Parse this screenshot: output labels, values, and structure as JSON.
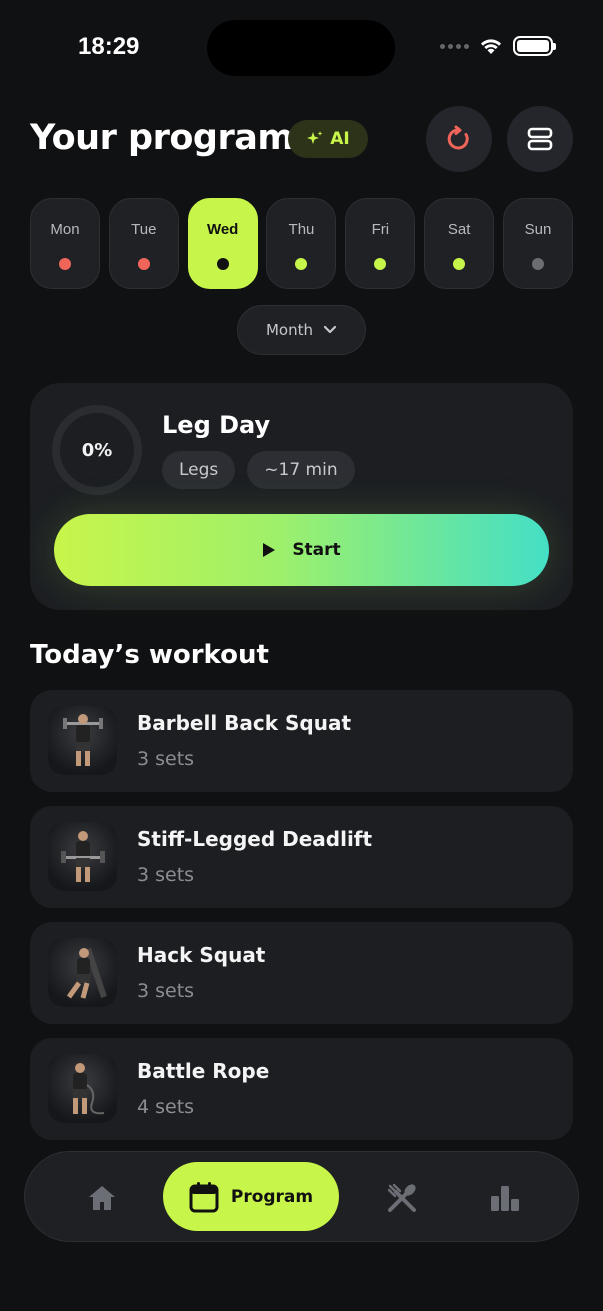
{
  "status_bar": {
    "time": "18:29"
  },
  "header": {
    "title": "Your program",
    "ai_label": "AI"
  },
  "days": [
    {
      "label": "Mon",
      "dot_color": "#f0655a",
      "active": false
    },
    {
      "label": "Tue",
      "dot_color": "#f0655a",
      "active": false
    },
    {
      "label": "Wed",
      "dot_color": "#111111",
      "active": true
    },
    {
      "label": "Thu",
      "dot_color": "#c8f54a",
      "active": false
    },
    {
      "label": "Fri",
      "dot_color": "#c8f54a",
      "active": false
    },
    {
      "label": "Sat",
      "dot_color": "#c8f54a",
      "active": false
    },
    {
      "label": "Sun",
      "dot_color": "#6a6d72",
      "active": false
    }
  ],
  "month_toggle": {
    "label": "Month"
  },
  "workout_card": {
    "progress": "0%",
    "title": "Leg Day",
    "tag_muscle": "Legs",
    "tag_duration": "~17 min",
    "start_label": "Start"
  },
  "section_title": "Today’s workout",
  "exercises": [
    {
      "name": "Barbell Back Squat",
      "sets": "3 sets"
    },
    {
      "name": "Stiff-Legged Deadlift",
      "sets": "3 sets"
    },
    {
      "name": "Hack Squat",
      "sets": "3 sets"
    },
    {
      "name": "Battle Rope",
      "sets": "4 sets"
    }
  ],
  "nav": {
    "home_icon": "home-icon",
    "program_label": "Program",
    "food_icon": "utensils-icon",
    "stats_icon": "bar-chart-icon"
  },
  "colors": {
    "accent": "#c8f54a",
    "accent_gradient_end": "#44dfc6",
    "refresh_icon": "#f0655a",
    "background": "#101113"
  }
}
